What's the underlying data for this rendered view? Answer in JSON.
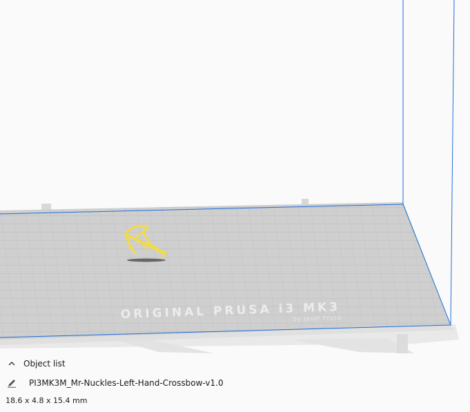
{
  "viewport": {
    "bed_label_main": "ORIGINAL PRUSA i3 MK3",
    "bed_label_sub": "by Josef Prusa",
    "model_color": "#f7e363",
    "build_volume_color": "#1e6fd9",
    "bed_color": "#cfcfcf"
  },
  "object_panel": {
    "title": "Object list",
    "collapse_icon": "chevron-up-icon",
    "items": [
      {
        "icon": "pencil-icon",
        "name": "PI3MK3M_Mr-Nuckles-Left-Hand-Crossbow-v1.0"
      }
    ],
    "dimensions": "18.6 x 4.8 x 15.4 mm"
  }
}
